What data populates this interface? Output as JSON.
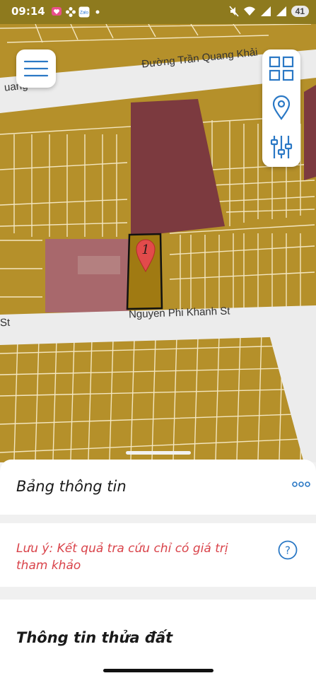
{
  "status_bar": {
    "time": "09:14",
    "battery": "41",
    "left_icons": [
      "heart-message-icon",
      "flower-icon",
      "zalo-icon",
      "dot-icon"
    ],
    "right_icons": [
      "mute-icon",
      "wifi-icon",
      "signal-icon",
      "signal-icon"
    ]
  },
  "map": {
    "streets": {
      "top": "Đường Trần Quang Khải",
      "top_left_fragment": "uang",
      "middle": "Nguyen Phi Khanh St",
      "middle_left_fragment": "St"
    },
    "marker": {
      "label": "1",
      "color": "#e24b4b"
    },
    "colors": {
      "residential": "#b5902a",
      "commercial": "#7c3a3f",
      "road": "#ececec",
      "selected_parcel": "#a07a12"
    }
  },
  "controls": {
    "menu_icon": "hamburger-icon",
    "toolbar": [
      "grid-icon",
      "location-pin-icon",
      "sliders-icon"
    ]
  },
  "panel": {
    "title": "Bảng thông tin",
    "more_icon": "more-dots-icon",
    "notice": "Lưu ý: Kết quả tra cứu chỉ có giá trị tham khảo",
    "help_icon": "question-circle-icon",
    "section_title": "Thông tin thửa đất"
  }
}
